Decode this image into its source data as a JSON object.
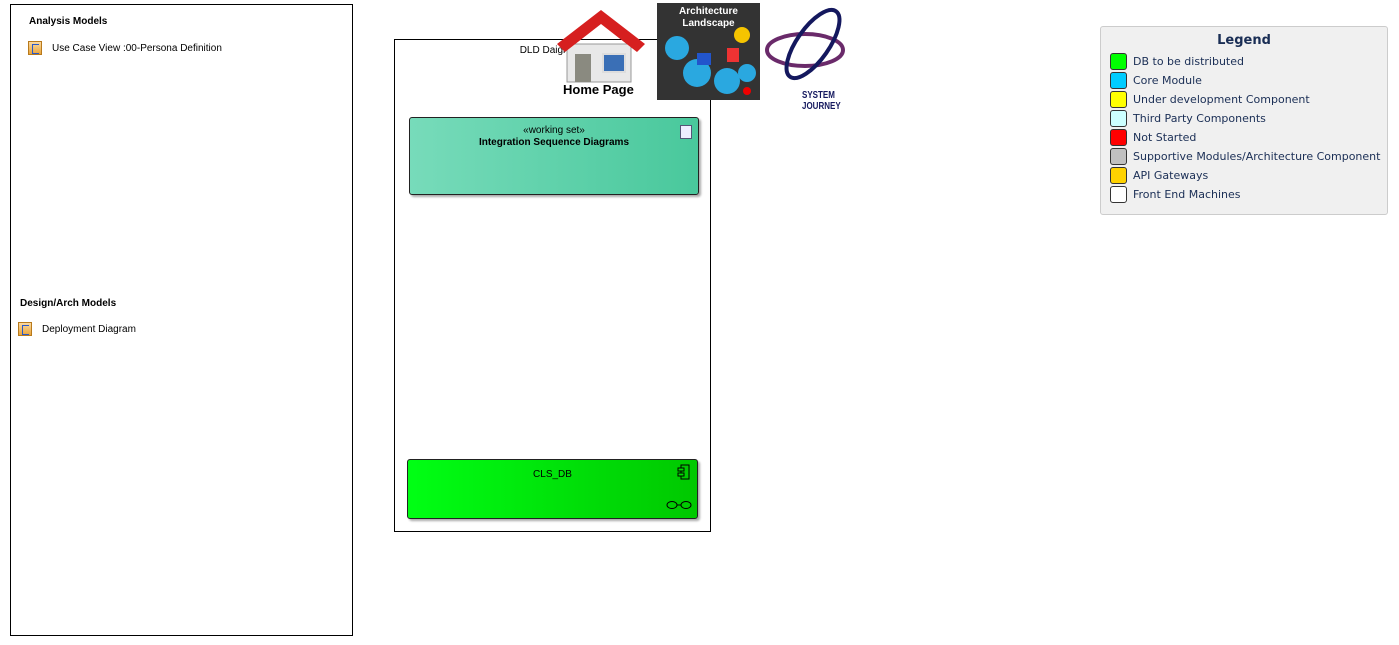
{
  "left_panel": {
    "sections": [
      {
        "title": "Analysis Models",
        "items": [
          "Use Case View :00-Persona Definition"
        ]
      },
      {
        "title": "Design/Arch Models",
        "items": [
          "Deployment Diagram"
        ]
      }
    ]
  },
  "package": {
    "title": "DLD Daigrams",
    "working_set": {
      "stereotype": "«working set»",
      "name": "Integration Sequence Diagrams"
    },
    "component": {
      "name": "CLS_DB"
    }
  },
  "nav_images": {
    "home": "Home Page",
    "architecture": "Architecture Landscape",
    "journey": "SYSTEM JOURNEY"
  },
  "legend": {
    "title": "Legend",
    "items": [
      {
        "label": "DB to be distributed",
        "color": "#00ff00"
      },
      {
        "label": "Core Module",
        "color": "#00ccff"
      },
      {
        "label": "Under development Component",
        "color": "#ffff00"
      },
      {
        "label": "Third Party Components",
        "color": "#ccffff"
      },
      {
        "label": "Not Started",
        "color": "#ff0000"
      },
      {
        "label": "Supportive Modules/Architecture Component",
        "color": "#c0c0c0"
      },
      {
        "label": "API Gateways",
        "color": "#ffd200"
      },
      {
        "label": "Front End Machines",
        "color": "#ffffff"
      }
    ]
  }
}
